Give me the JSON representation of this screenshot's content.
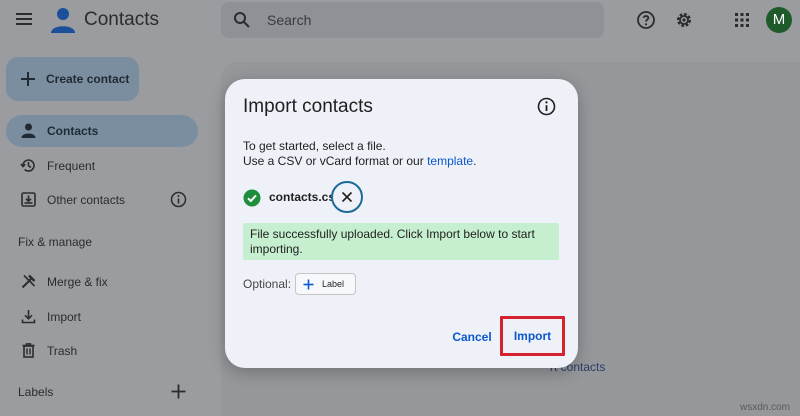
{
  "app": {
    "title": "Contacts",
    "avatar_initial": "M"
  },
  "search": {
    "placeholder": "Search"
  },
  "sidebar": {
    "create_label": "Create contact",
    "items": [
      {
        "label": "Contacts",
        "active": true
      },
      {
        "label": "Frequent"
      },
      {
        "label": "Other contacts"
      },
      {
        "label": "Merge & fix"
      },
      {
        "label": "Import"
      },
      {
        "label": "Trash"
      }
    ],
    "section_fix": "Fix & manage",
    "section_labels": "Labels"
  },
  "background": {
    "import_contacts_fragment": "rt contacts"
  },
  "dialog": {
    "title": "Import contacts",
    "line1": "To get started, select a file.",
    "line2_prefix": "Use a CSV or vCard format or our ",
    "line2_link": "template",
    "line2_suffix": ".",
    "file_name": "contacts.csv",
    "success_message": "File successfully uploaded. Click Import below to start importing.",
    "optional_label": "Optional:",
    "label_button": "Label",
    "cancel_label": "Cancel",
    "import_label": "Import"
  },
  "watermark": "wsxdn.com",
  "colors": {
    "accent": "#0b57d0",
    "success_bg": "#c6efcf",
    "success_icon": "#1e8e3e",
    "highlight": "#d6212e"
  }
}
